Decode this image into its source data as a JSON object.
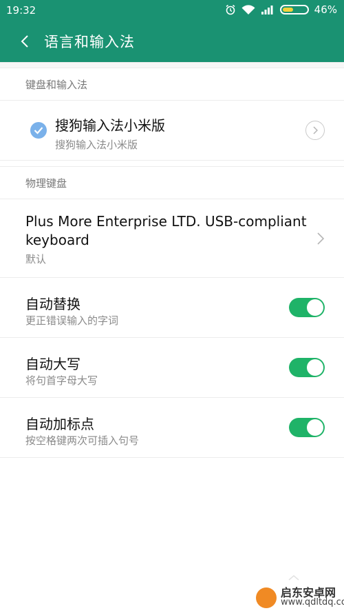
{
  "status_bar": {
    "time": "19:32",
    "battery_percent_label": "46%",
    "battery_level": 0.46,
    "icons": [
      "alarm-icon",
      "wifi-icon",
      "signal-icon",
      "battery-icon"
    ]
  },
  "header": {
    "title": "语言和输入法",
    "color": "#1a9272"
  },
  "keyboard_section": {
    "label": "键盘和输入法",
    "ime": {
      "title": "搜狗输入法小米版",
      "subtitle": "搜狗输入法小米版",
      "checked": true
    }
  },
  "physical_section": {
    "label": "物理键盘",
    "keyboard": {
      "title": "Plus More Enterprise LTD. USB-compliant keyboard",
      "subtitle": "默认"
    }
  },
  "toggles": [
    {
      "title": "自动替换",
      "subtitle": "更正错误输入的字词",
      "on": true
    },
    {
      "title": "自动大写",
      "subtitle": "将句首字母大写",
      "on": true
    },
    {
      "title": "自动加标点",
      "subtitle": "按空格键两次可插入句号",
      "on": true
    }
  ],
  "watermark": {
    "line1": "启东安卓网",
    "line2": "www.qdltdq.com"
  },
  "colors": {
    "accent": "#1a9272",
    "switch_on": "#1fb368",
    "check": "#7ab1ea"
  }
}
